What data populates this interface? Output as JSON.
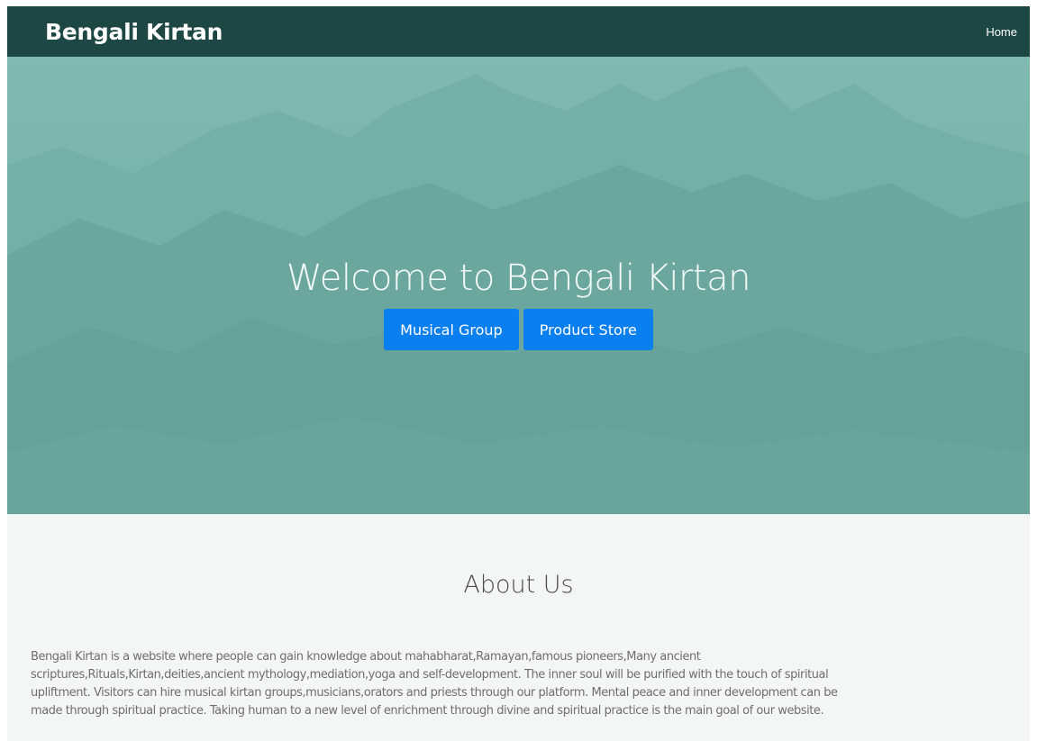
{
  "nav": {
    "brand": "Bengali Kirtan",
    "home": "Home"
  },
  "hero": {
    "title": "Welcome to Bengali Kirtan",
    "buttons": {
      "musical_group": "Musical Group",
      "product_store": "Product Store"
    }
  },
  "about": {
    "title": "About Us",
    "lines": [
      "Bengali Kirtan is a website where people can gain knowledge about mahabharat,Ramayan,famous pioneers,Many ancient",
      "scriptures,Rituals,Kirtan,deities,ancient mythology,mediation,yoga and self-development. The inner soul will be purified with the touch of spiritual",
      "upliftment. Visitors can hire musical kirtan groups,musicians,orators and priests through our platform. Mental peace and inner development can be",
      "made through spiritual practice. Taking human to a new level of enrichment through divine and spiritual practice is the main goal of our website."
    ]
  },
  "colors": {
    "navbar": "#1d4744",
    "hero": "#71aea7",
    "button": "#0a7ff0",
    "about_bg": "#f2f7f6"
  }
}
